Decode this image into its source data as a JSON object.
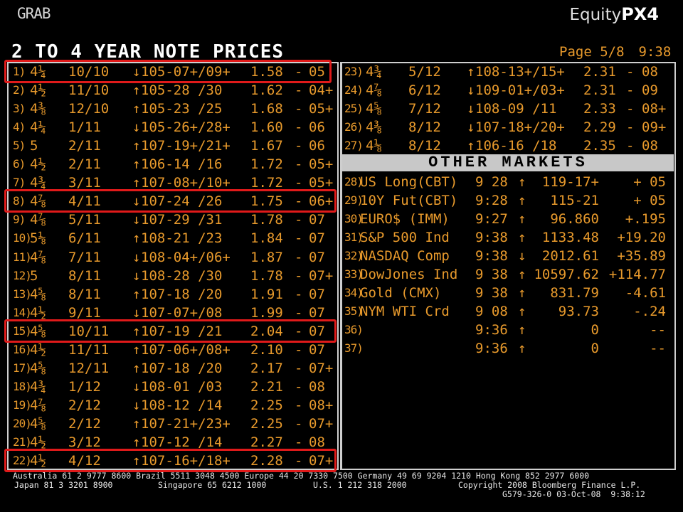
{
  "header": {
    "grab_label": "GRAB",
    "brand_prefix": "Equity",
    "brand_code": "PX4"
  },
  "screen": {
    "title": "2 TO 4 YEAR NOTE PRICES",
    "page": "Page 5/8",
    "time": "9:38"
  },
  "colors": {
    "text_amber": "#e89a2c",
    "title_white": "#ffffff",
    "panel_border": "#cfcfcf",
    "header_bar": "#c8c8c8",
    "highlight_red": "#e01a1a",
    "background": "#000000"
  },
  "notes_left": [
    {
      "idx": "1)",
      "coupon": "4¼",
      "maturity": "10/10",
      "arrow": "↓",
      "price": "105-07+/09+",
      "yield": "1.58",
      "sep": "-",
      "chg": "05"
    },
    {
      "idx": "2)",
      "coupon": "4½",
      "maturity": "11/10",
      "arrow": "↑",
      "price": "105-28 /30",
      "yield": "1.62",
      "sep": "-",
      "chg": "04+"
    },
    {
      "idx": "3)",
      "coupon": "4⅜",
      "maturity": "12/10",
      "arrow": "↑",
      "price": "105-23 /25",
      "yield": "1.68",
      "sep": "-",
      "chg": "05+"
    },
    {
      "idx": "4)",
      "coupon": "4¼",
      "maturity": "1/11",
      "arrow": "↓",
      "price": "105-26+/28+",
      "yield": "1.60",
      "sep": "-",
      "chg": "06"
    },
    {
      "idx": "5)",
      "coupon": "5",
      "maturity": "2/11",
      "arrow": "↑",
      "price": "107-19+/21+",
      "yield": "1.67",
      "sep": "-",
      "chg": "06"
    },
    {
      "idx": "6)",
      "coupon": "4½",
      "maturity": "2/11",
      "arrow": "↑",
      "price": "106-14 /16",
      "yield": "1.72",
      "sep": "-",
      "chg": "05+"
    },
    {
      "idx": "7)",
      "coupon": "4¾",
      "maturity": "3/11",
      "arrow": "↑",
      "price": "107-08+/10+",
      "yield": "1.72",
      "sep": "-",
      "chg": "05+"
    },
    {
      "idx": "8)",
      "coupon": "4⅞",
      "maturity": "4/11",
      "arrow": "↓",
      "price": "107-24 /26",
      "yield": "1.75",
      "sep": "-",
      "chg": "06+"
    },
    {
      "idx": "9)",
      "coupon": "4⅞",
      "maturity": "5/11",
      "arrow": "↓",
      "price": "107-29 /31",
      "yield": "1.78",
      "sep": "-",
      "chg": "07"
    },
    {
      "idx": "10)",
      "coupon": "5⅛",
      "maturity": "6/11",
      "arrow": "↑",
      "price": "108-21 /23",
      "yield": "1.84",
      "sep": "-",
      "chg": "07"
    },
    {
      "idx": "11)",
      "coupon": "4⅞",
      "maturity": "7/11",
      "arrow": "↓",
      "price": "108-04+/06+",
      "yield": "1.87",
      "sep": "-",
      "chg": "07"
    },
    {
      "idx": "12)",
      "coupon": "5",
      "maturity": "8/11",
      "arrow": "↓",
      "price": "108-28 /30",
      "yield": "1.78",
      "sep": "-",
      "chg": "07+"
    },
    {
      "idx": "13)",
      "coupon": "4⅝",
      "maturity": "8/11",
      "arrow": "↑",
      "price": "107-18 /20",
      "yield": "1.91",
      "sep": "-",
      "chg": "07"
    },
    {
      "idx": "14)",
      "coupon": "4½",
      "maturity": "9/11",
      "arrow": "↓",
      "price": "107-07+/08",
      "yield": "1.99",
      "sep": "-",
      "chg": "07"
    },
    {
      "idx": "15)",
      "coupon": "4⅝",
      "maturity": "10/11",
      "arrow": "↑",
      "price": "107-19 /21",
      "yield": "2.04",
      "sep": "-",
      "chg": "07"
    },
    {
      "idx": "16)",
      "coupon": "4½",
      "maturity": "11/11",
      "arrow": "↑",
      "price": "107-06+/08+",
      "yield": "2.10",
      "sep": "-",
      "chg": "07"
    },
    {
      "idx": "17)",
      "coupon": "4⅝",
      "maturity": "12/11",
      "arrow": "↑",
      "price": "107-18 /20",
      "yield": "2.17",
      "sep": "-",
      "chg": "07+"
    },
    {
      "idx": "18)",
      "coupon": "4¾",
      "maturity": "1/12",
      "arrow": "↓",
      "price": "108-01 /03",
      "yield": "2.21",
      "sep": "-",
      "chg": "08"
    },
    {
      "idx": "19)",
      "coupon": "4⅞",
      "maturity": "2/12",
      "arrow": "↓",
      "price": "108-12 /14",
      "yield": "2.25",
      "sep": "-",
      "chg": "08+"
    },
    {
      "idx": "20)",
      "coupon": "4⅝",
      "maturity": "2/12",
      "arrow": "↑",
      "price": "107-21+/23+",
      "yield": "2.25",
      "sep": "-",
      "chg": "07+"
    },
    {
      "idx": "21)",
      "coupon": "4½",
      "maturity": "3/12",
      "arrow": "↑",
      "price": "107-12 /14",
      "yield": "2.27",
      "sep": "-",
      "chg": "08"
    },
    {
      "idx": "22)",
      "coupon": "4½",
      "maturity": "4/12",
      "arrow": "↑",
      "price": "107-16+/18+",
      "yield": "2.28",
      "sep": "-",
      "chg": "07+"
    }
  ],
  "notes_right": [
    {
      "idx": "23)",
      "coupon": "4¾",
      "maturity": "5/12",
      "arrow": "↑",
      "price": "108-13+/15+",
      "yield": "2.31",
      "sep": "-",
      "chg": "08"
    },
    {
      "idx": "24)",
      "coupon": "4⅞",
      "maturity": "6/12",
      "arrow": "↓",
      "price": "109-01+/03+",
      "yield": "2.31",
      "sep": "-",
      "chg": "09"
    },
    {
      "idx": "25)",
      "coupon": "4⅝",
      "maturity": "7/12",
      "arrow": "↓",
      "price": "108-09 /11",
      "yield": "2.33",
      "sep": "-",
      "chg": "08+"
    },
    {
      "idx": "26)",
      "coupon": "4⅜",
      "maturity": "8/12",
      "arrow": "↓",
      "price": "107-18+/20+",
      "yield": "2.29",
      "sep": "-",
      "chg": "09+"
    },
    {
      "idx": "27)",
      "coupon": "4⅛",
      "maturity": "8/12",
      "arrow": "↑",
      "price": "106-16 /18",
      "yield": "2.35",
      "sep": "-",
      "chg": "08"
    }
  ],
  "other_markets": {
    "title": "OTHER MARKETS",
    "rows": [
      {
        "idx": "28)",
        "name": "US Long(CBT)",
        "time": "9 28",
        "arrow": "↑",
        "value": "119-17+",
        "chg": "+ 05"
      },
      {
        "idx": "29)",
        "name": "10Y Fut(CBT)",
        "time": "9:28",
        "arrow": "↑",
        "value": "115-21",
        "chg": "+ 05"
      },
      {
        "idx": "30)",
        "name": "EURO$ (IMM)",
        "time": "9:27",
        "arrow": "↑",
        "value": "96.860",
        "chg": "+.195"
      },
      {
        "idx": "31)",
        "name": "S&P 500 Ind",
        "time": "9:38",
        "arrow": "↑",
        "value": "1133.48",
        "chg": "+19.20"
      },
      {
        "idx": "32)",
        "name": "NASDAQ Comp",
        "time": "9:38",
        "arrow": "↓",
        "value": "2012.61",
        "chg": "+35.89"
      },
      {
        "idx": "33)",
        "name": "DowJones Ind",
        "time": "9 38",
        "arrow": "↑",
        "value": "10597.62",
        "chg": "+114.77"
      },
      {
        "idx": "34)",
        "name": "Gold (CMX)",
        "time": "9 38",
        "arrow": "↑",
        "value": "831.79",
        "chg": "-4.61"
      },
      {
        "idx": "35)",
        "name": "NYM WTI Crd",
        "time": "9 08",
        "arrow": "↑",
        "value": "93.73",
        "chg": "-.24"
      },
      {
        "idx": "36)",
        "name": "",
        "time": "9:36",
        "arrow": "↑",
        "value": "0",
        "chg": "--"
      },
      {
        "idx": "37)",
        "name": "",
        "time": "9:36",
        "arrow": "↑",
        "value": "0",
        "chg": "--"
      }
    ]
  },
  "highlighted_rows": [
    "1)",
    "8)",
    "15)",
    "22)"
  ],
  "footer": {
    "line1": "Australia 61 2 9777 8600 Brazil 5511 3048 4500 Europe 44 20 7330 7500 Germany 49 69 9204 1210 Hong Kong 852 2977 6000",
    "line2_left": "Japan 81 3 3201 8900",
    "line2_mid1": "Singapore 65 6212 1000",
    "line2_mid2": "U.S. 1 212 318 2000",
    "line2_right": "Copyright 2008 Bloomberg Finance L.P.",
    "line3": "G579-326-0 03-Oct-08  9:38:12"
  }
}
